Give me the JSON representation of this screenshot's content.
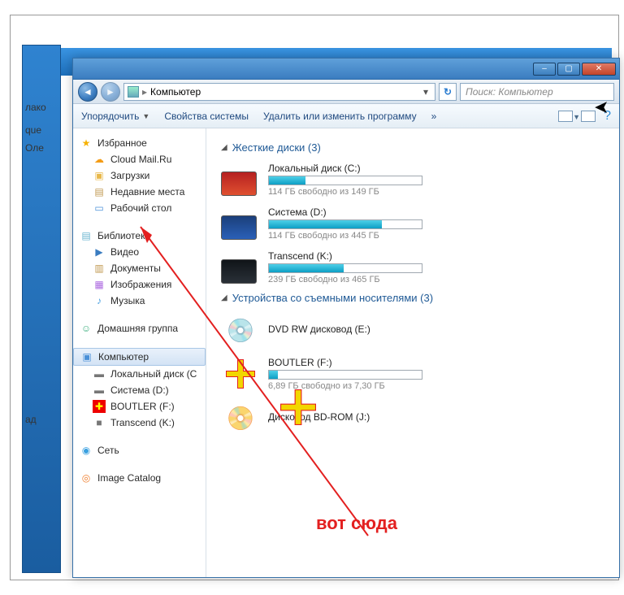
{
  "bg": {
    "line1": "лако",
    "line2": "que",
    "line3": "Оле",
    "line4": "ад"
  },
  "titlebar": {
    "min": "–",
    "max": "▢",
    "close": "✕"
  },
  "address": {
    "location": "Компьютер",
    "refresh": "↻",
    "search_placeholder": "Поиск: Компьютер"
  },
  "toolbar": {
    "organize": "Упорядочить",
    "props": "Свойства системы",
    "uninstall": "Удалить или изменить программу",
    "more": "»"
  },
  "sidebar": {
    "fav": "Избранное",
    "fav_items": [
      {
        "label": "Cloud Mail.Ru",
        "icon": "cloud-icon"
      },
      {
        "label": "Загрузки",
        "icon": "folder-icon"
      },
      {
        "label": "Недавние места",
        "icon": "docs-icon"
      },
      {
        "label": "Рабочий стол",
        "icon": "desktop-icon"
      }
    ],
    "lib": "Библиотеки",
    "lib_items": [
      {
        "label": "Видео",
        "icon": "video-icon"
      },
      {
        "label": "Документы",
        "icon": "doc-icon"
      },
      {
        "label": "Изображения",
        "icon": "image-icon"
      },
      {
        "label": "Музыка",
        "icon": "music-icon"
      }
    ],
    "home": "Домашняя группа",
    "comp": "Компьютер",
    "comp_items": [
      {
        "label": "Локальный диск (C",
        "icon": "hdd-icon"
      },
      {
        "label": "Система (D:)",
        "icon": "hdd-icon"
      },
      {
        "label": "BOUTLER (F:)",
        "icon": "usb-icon"
      },
      {
        "label": "Transcend (K:)",
        "icon": "hdd-ext-icon"
      }
    ],
    "net": "Сеть",
    "imgcat": "Image Catalog"
  },
  "content": {
    "hdd_header": "Жесткие диски (3)",
    "hdd": [
      {
        "name": "Локальный диск (C:)",
        "free": "114 ГБ свободно из 149 ГБ",
        "fill": 24,
        "color1": "#b52020",
        "color2": "#e05030"
      },
      {
        "name": "Система (D:)",
        "free": "114 ГБ свободно из 445 ГБ",
        "fill": 74,
        "color1": "#1b3f7a",
        "color2": "#2a60b8"
      },
      {
        "name": "Transcend (K:)",
        "free": "239 ГБ свободно из 465 ГБ",
        "fill": 49,
        "color1": "#101418",
        "color2": "#2a3038"
      }
    ],
    "rem_header": "Устройства со съемными носителями (3)",
    "rem": [
      {
        "name": "DVD RW дисковод (E:)",
        "type": "dvd",
        "bar": false
      },
      {
        "name": "BOUTLER (F:)",
        "type": "usb",
        "bar": true,
        "fill": 6,
        "free": "6,89 ГБ свободно из 7,30 ГБ"
      },
      {
        "name": "Дисковод BD-ROM (J:)",
        "type": "bd",
        "bar": false
      }
    ]
  },
  "annotation": {
    "text": "вот сюда"
  }
}
